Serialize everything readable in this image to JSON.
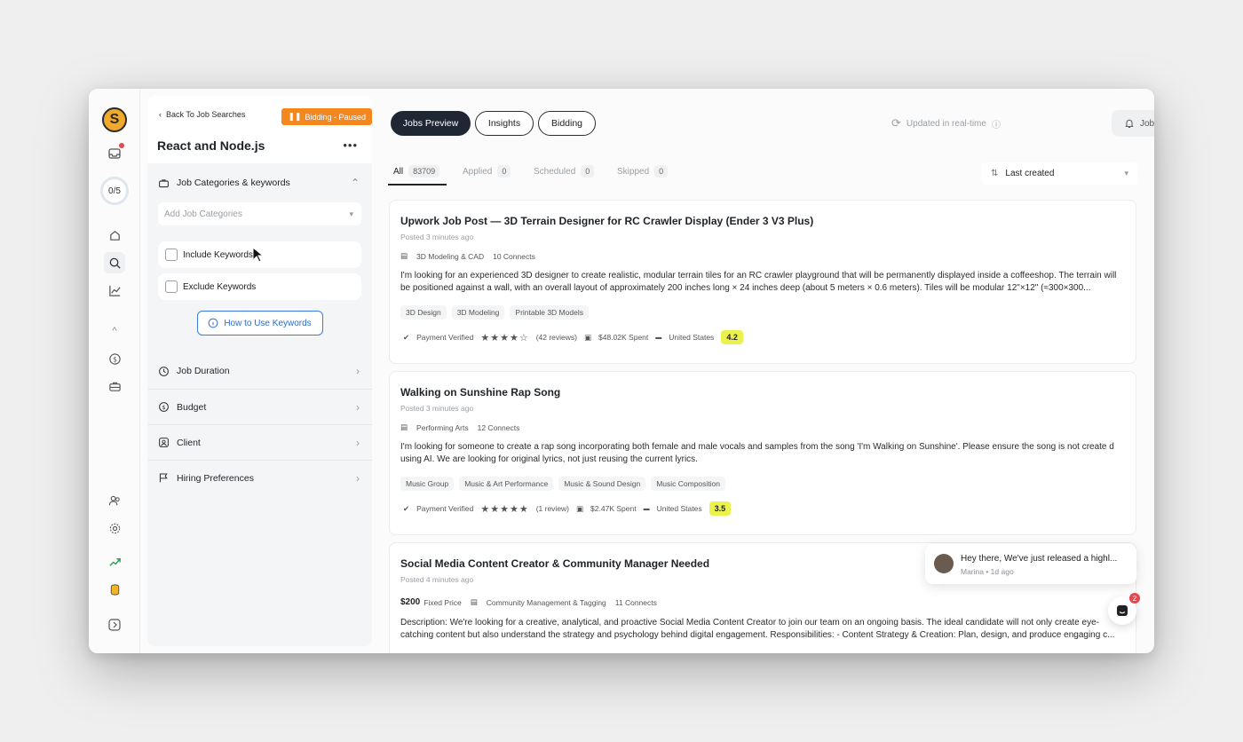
{
  "sidebar": {
    "logo_letter": "S",
    "progress_label": "0/5"
  },
  "filters": {
    "back_label": "Back To Job Searches",
    "bidding_status": "Bidding - Paused",
    "search_title": "React and Node.js",
    "more_label": "•••",
    "categories_heading": "Job Categories & keywords",
    "categories_placeholder": "Add Job Categories",
    "include_keywords": "Include Keywords",
    "exclude_keywords": "Exclude Keywords",
    "how_to_label": "How to Use Keywords",
    "sections": [
      "Job Duration",
      "Budget",
      "Client",
      "Hiring Preferences"
    ]
  },
  "header": {
    "tabs": [
      "Jobs Preview",
      "Insights",
      "Bidding"
    ],
    "updated_label": "Updated in real-time",
    "notifications_label": "Jobs Notifications"
  },
  "subtabs": [
    {
      "label": "All",
      "count": "83709"
    },
    {
      "label": "Applied",
      "count": "0"
    },
    {
      "label": "Scheduled",
      "count": "0"
    },
    {
      "label": "Skipped",
      "count": "0"
    }
  ],
  "sort": {
    "label": "Last created"
  },
  "jobs": [
    {
      "title": "Upwork Job Post — 3D Terrain Designer for RC Crawler Display (Ender 3 V3 Plus)",
      "posted": "Posted 3 minutes ago",
      "category": "3D Modeling & CAD",
      "connects": "10 Connects",
      "description": "I'm looking for an experienced 3D designer to create realistic, modular terrain tiles for an RC crawler playground that will be permanently displayed inside a coffeeshop. The terrain will be positioned against a wall, with an overall layout of approximately 200 inches long × 24 inches deep (about 5 meters × 0.6 meters). Tiles will be modular 12\"×12\" (≈300×300...",
      "tags": [
        "3D Design",
        "3D Modeling",
        "Printable 3D Models"
      ],
      "payment": "Payment Verified",
      "reviews": "(42 reviews)",
      "spent": "$48.02K Spent",
      "country": "United States",
      "score": "4.2"
    },
    {
      "title": "Walking on Sunshine Rap Song",
      "posted": "Posted 3 minutes ago",
      "category": "Performing Arts",
      "connects": "12 Connects",
      "description": "I'm looking for someone to create a rap song incorporating both female and male vocals and samples from the song 'I'm Walking on Sunshine'. Please ensure the song is not create d using AI. We are looking for original lyrics, not just reusing the current lyrics.",
      "tags": [
        "Music Group",
        "Music & Art Performance",
        "Music & Sound Design",
        "Music Composition"
      ],
      "payment": "Payment Verified",
      "reviews": "(1 review)",
      "spent": "$2.47K Spent",
      "country": "United States",
      "score": "3.5"
    },
    {
      "title": "Social Media Content Creator & Community Manager Needed",
      "posted": "Posted 4 minutes ago",
      "price": "$200",
      "price_type": "Fixed Price",
      "category": "Community Management & Tagging",
      "connects": "11 Connects",
      "description": "Description: We're looking for a creative, analytical, and proactive Social Media Content Creator to join our team on an ongoing basis. The ideal candidate will not only create eye-catching content but also understand the strategy and psychology behind digital engagement. Responsibilities: - Content Strategy & Creation: Plan, design, and produce engaging c..."
    }
  ],
  "chat": {
    "message": "Hey there, We've just released a highl...",
    "sender": "Marina • 1d ago",
    "badge": "2"
  },
  "colors": {
    "accent_orange": "#f5871f",
    "tab_active": "#1f2734",
    "score_bg": "#eaf24b",
    "link_blue": "#2d6cc9"
  }
}
